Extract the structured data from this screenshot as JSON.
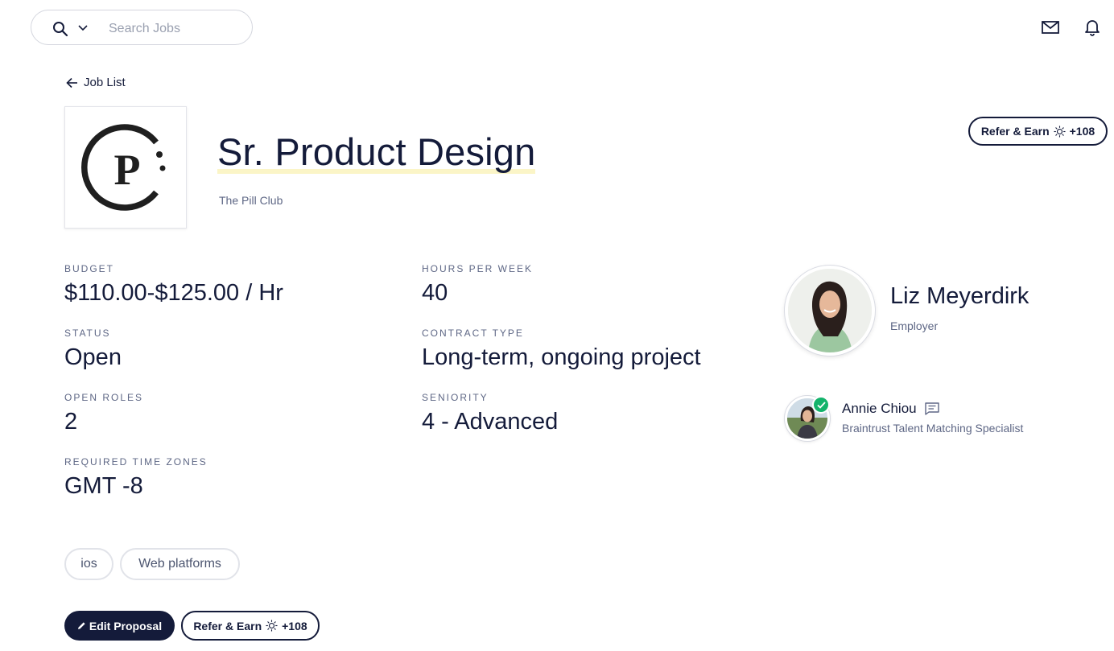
{
  "search": {
    "placeholder": "Search Jobs"
  },
  "nav": {
    "back_label": "Job List"
  },
  "job": {
    "title": "Sr. Product Design",
    "company": "The Pill Club",
    "logo_letter": "P"
  },
  "refer": {
    "label": "Refer & Earn",
    "points": "+108"
  },
  "details": {
    "budget": {
      "label": "BUDGET",
      "value": "$110.00-$125.00 / Hr"
    },
    "hours": {
      "label": "HOURS PER WEEK",
      "value": "40"
    },
    "status": {
      "label": "STATUS",
      "value": "Open"
    },
    "contract": {
      "label": "CONTRACT TYPE",
      "value": "Long-term, ongoing project"
    },
    "roles": {
      "label": "OPEN ROLES",
      "value": "2"
    },
    "seniority": {
      "label": "SENIORITY",
      "value": "4 - Advanced"
    },
    "timezones": {
      "label": "REQUIRED TIME ZONES",
      "value": "GMT -8"
    }
  },
  "employer": {
    "name": "Liz Meyerdirk",
    "role": "Employer"
  },
  "specialist": {
    "name": "Annie Chiou",
    "role": "Braintrust Talent Matching Specialist"
  },
  "skills": [
    "ios",
    "Web platforms"
  ],
  "actions": {
    "edit_label": "Edit Proposal"
  },
  "icons": {
    "search": "search-icon",
    "chevron": "chevron-down-icon",
    "mail": "mail-icon",
    "bell": "bell-icon",
    "back": "arrow-left-icon",
    "token": "token-icon",
    "message": "message-icon",
    "pencil": "pencil-icon",
    "check": "check-icon"
  },
  "colors": {
    "text": "#141b3a",
    "muted": "#5e6785",
    "highlight": "#fbf5c7",
    "verified": "#13b36b"
  }
}
